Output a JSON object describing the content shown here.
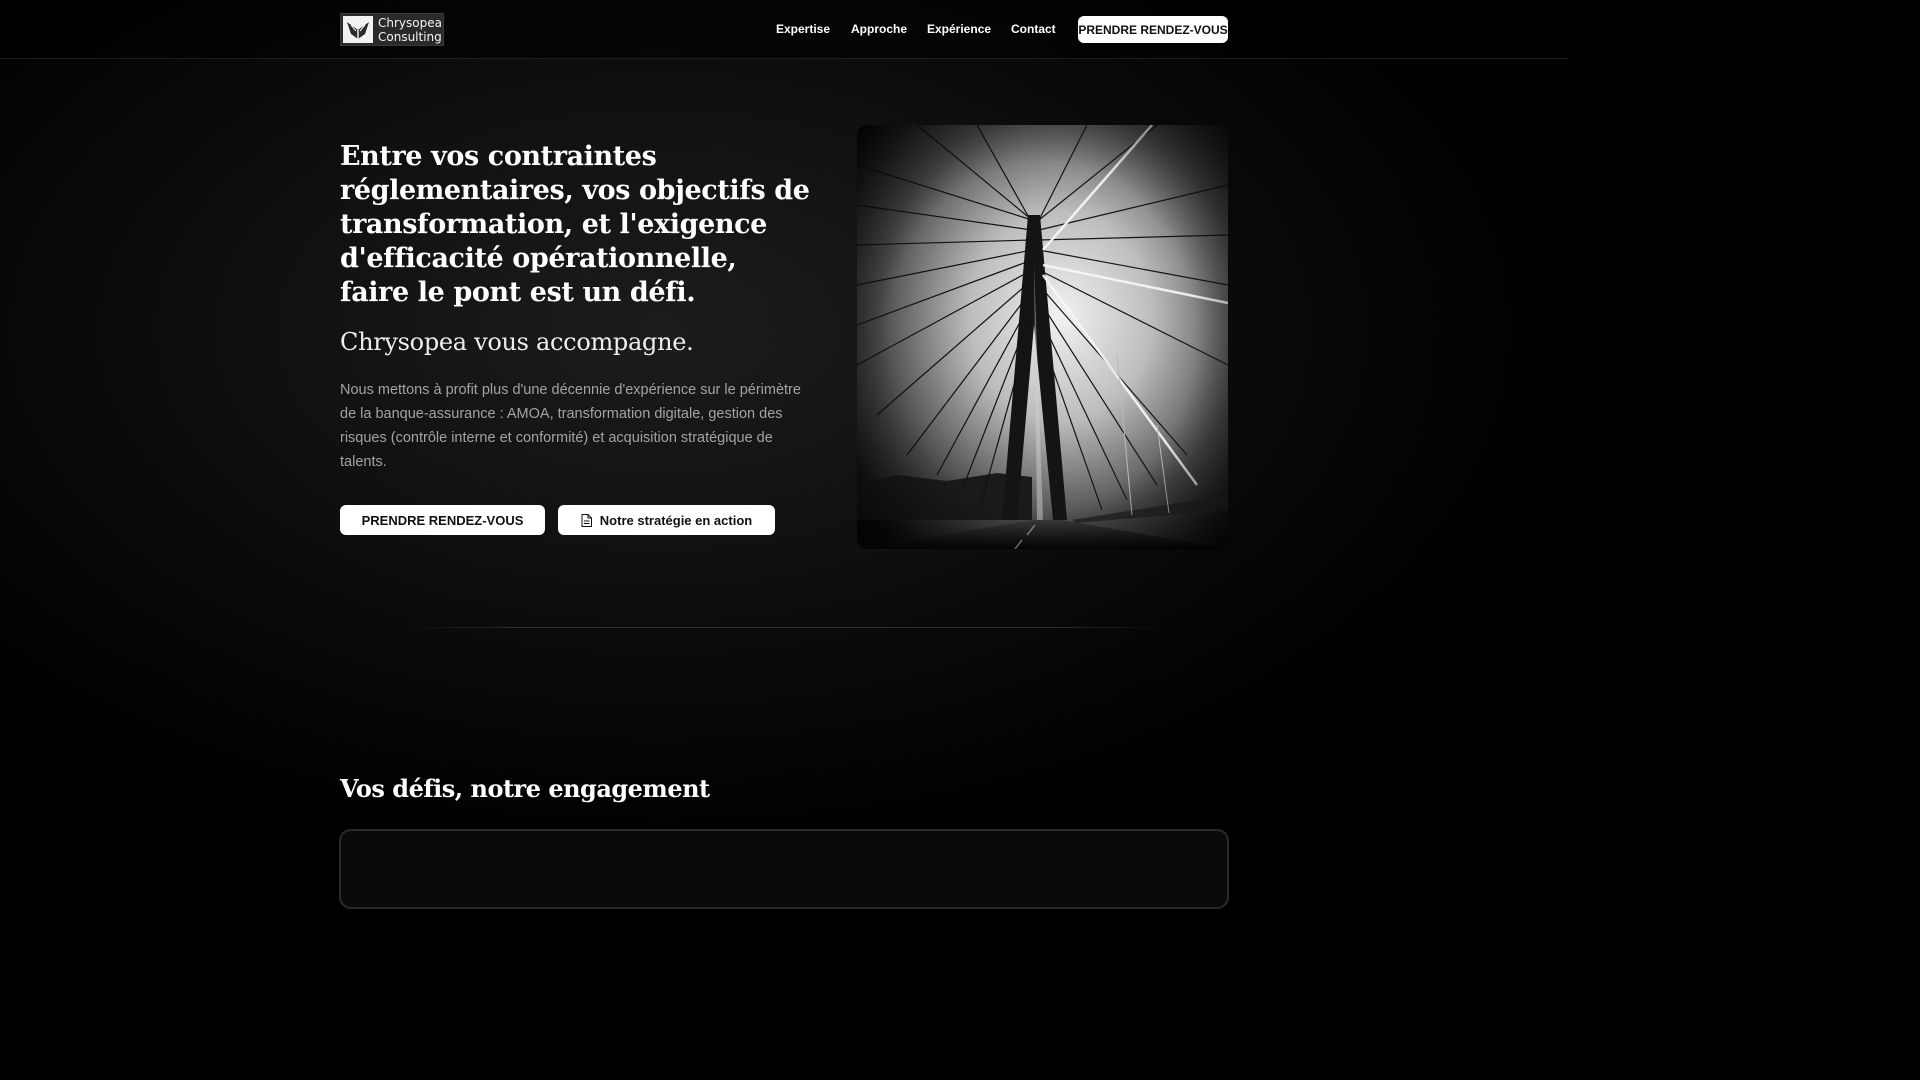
{
  "brand": {
    "line1": "Chrysopea",
    "line2": "Consulting",
    "logo_icon": "chrysalis-wings-icon"
  },
  "nav": {
    "items": [
      {
        "label": "Expertise"
      },
      {
        "label": "Approche"
      },
      {
        "label": "Expérience"
      },
      {
        "label": "Contact"
      }
    ],
    "cta_label": "PRENDRE RENDEZ-VOUS"
  },
  "hero": {
    "title": "Entre vos contraintes réglementaires, vos objectifs de transformation, et l'exigence d'efficacité opérationnelle, faire le pont est un défi.",
    "subtitle": "Chrysopea vous accompagne.",
    "description": "Nous mettons à profit plus d'une décennie d'expérience sur le périmètre de la banque-assurance : AMOA, transformation digitale, gestion des risques (contrôle interne et conformité) et acquisition stratégique de talents.",
    "primary_button": "PRENDRE RENDEZ-VOUS",
    "secondary_button": "Notre stratégie en action",
    "secondary_icon": "document-icon",
    "image_subject": "cable-stayed-bridge-photo"
  },
  "section": {
    "title": "Vos défis, notre engagement"
  },
  "colors": {
    "background": "#000000",
    "text": "#ffffff",
    "muted_text": "#a3a3a3",
    "button_bg": "#ffffff",
    "button_text": "#111111"
  }
}
